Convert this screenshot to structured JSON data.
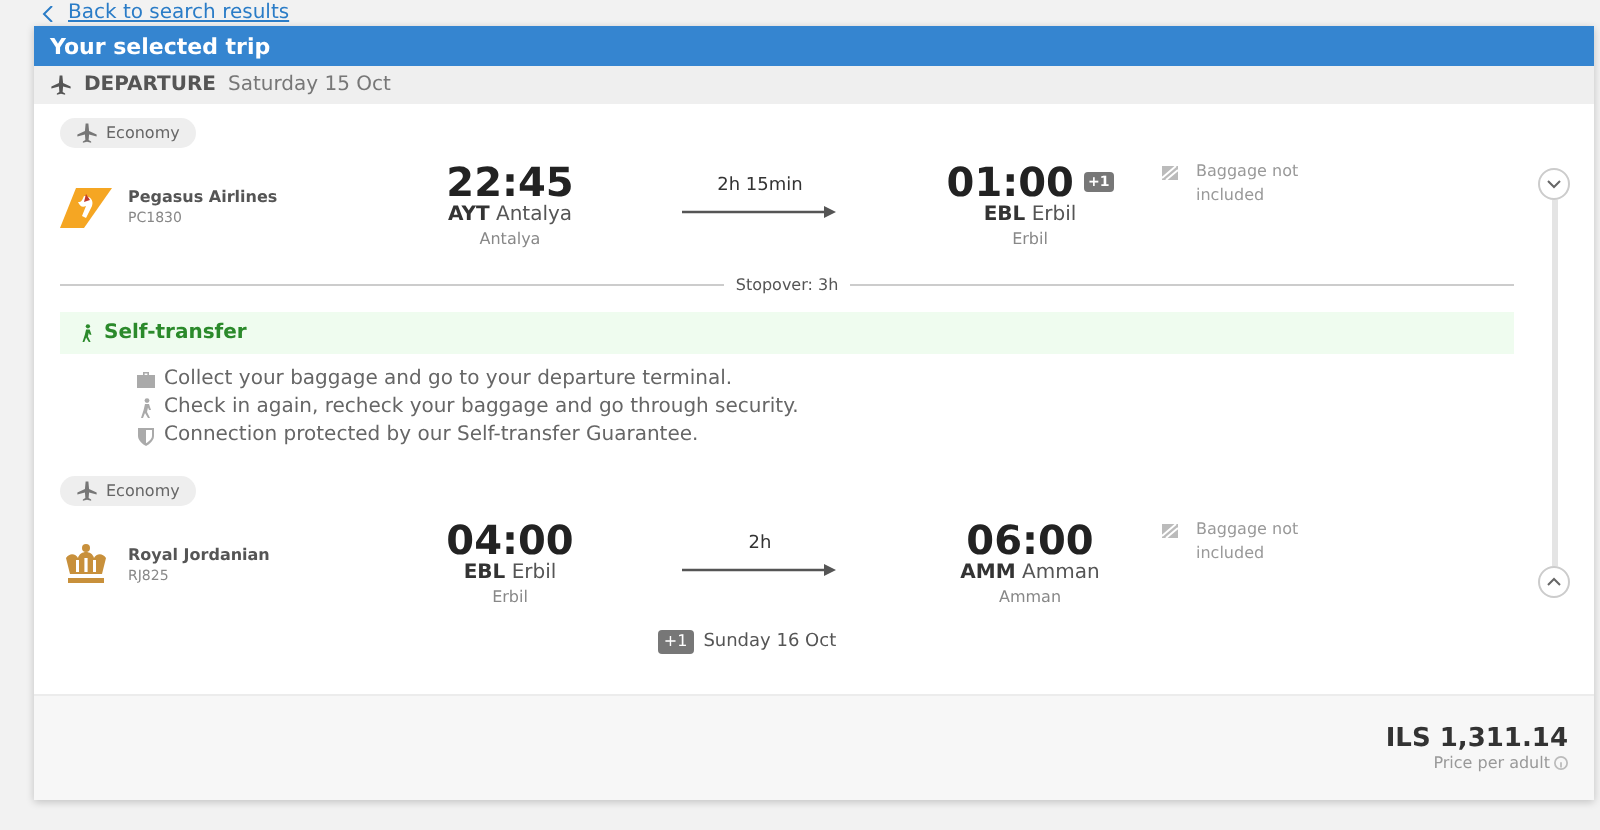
{
  "back_link": "Back to search results",
  "title": "Your selected trip",
  "direction": {
    "label": "DEPARTURE",
    "date": "Saturday 15 Oct"
  },
  "segments": [
    {
      "cabin": "Economy",
      "airline": "Pegasus Airlines",
      "flight": "PC1830",
      "dep": {
        "time": "22:45",
        "code": "AYT",
        "city": "Antalya",
        "airport": "Antalya"
      },
      "duration": "2h 15min",
      "arr": {
        "time": "01:00",
        "next_day": "+1",
        "code": "EBL",
        "city": "Erbil",
        "airport": "Erbil"
      },
      "baggage": "Baggage not included"
    },
    {
      "cabin": "Economy",
      "airline": "Royal Jordanian",
      "flight": "RJ825",
      "dep": {
        "time": "04:00",
        "code": "EBL",
        "city": "Erbil",
        "airport": "Erbil"
      },
      "duration": "2h",
      "arr": {
        "time": "06:00",
        "code": "AMM",
        "city": "Amman",
        "airport": "Amman"
      },
      "baggage": "Baggage not included"
    }
  ],
  "stopover": "Stopover: 3h",
  "self_transfer": {
    "title": "Self-transfer",
    "notes": [
      {
        "kind": "bag",
        "text": "Collect your baggage and go to your departure terminal."
      },
      {
        "kind": "walk",
        "text": "Check in again, recheck your baggage and go through security."
      },
      {
        "kind": "shield",
        "text": "Connection protected by our Self-transfer Guarantee."
      }
    ]
  },
  "arrival_note": {
    "badge": "+1",
    "date": "Sunday 16 Oct"
  },
  "price": {
    "amount": "ILS 1,311.14",
    "label": "Price per adult"
  }
}
